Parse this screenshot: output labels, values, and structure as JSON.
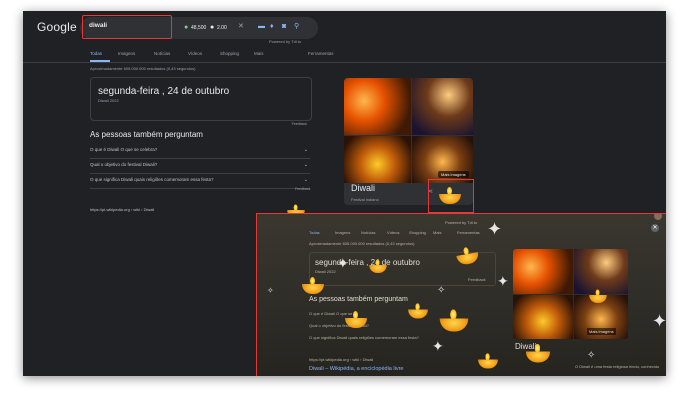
{
  "brand": {
    "logo": "Google"
  },
  "search": {
    "query": "diwali",
    "count_a": "48,500",
    "count_b": "2.00",
    "powered": "Powered by Tdl.to"
  },
  "tabs": [
    {
      "label": "Todas"
    },
    {
      "label": "Imagens"
    },
    {
      "label": "Notícias"
    },
    {
      "label": "Vídeos"
    },
    {
      "label": "Shopping"
    },
    {
      "label": "Mais"
    },
    {
      "label": "Ferramentas"
    }
  ],
  "stats": "Aproximadamente 605.000.000 resultados (0,43 segundos)",
  "date_card": {
    "main": "segunda-feira , 24 de outubro",
    "sub": "Diwali 2022",
    "feedback": "Feedback"
  },
  "paa": {
    "title": "As pessoas também perguntam",
    "questions": [
      "O que é Diwali O que se celebra?",
      "Qual o objetivo do festival Diwali?",
      "O que significa Diwali quais religiões comemoram essa festa?"
    ],
    "feedback": "Feedback"
  },
  "result": {
    "url": "https://pt.wikipedia.org › wiki › Diwali"
  },
  "knowledge": {
    "title": "Diwali",
    "subtitle": "Festival indiano",
    "more_images": "Mais imagens"
  },
  "overlay": {
    "date_main": "segunda-feira , 24 de outubro",
    "date_sub": "Diwali 2022",
    "paa_title": "As pessoas também perguntam",
    "q1": "O que é Diwali O que se ...",
    "q2": "Qual o objetivo do festival Diwali?",
    "q3": "O que significa Diwali quais religiões comemoram essa festa?",
    "url": "https://pt.wikipedia.org › wiki › Diwali",
    "link": "Diwali – Wikipédia, a enciclopédia livre",
    "kp_title": "Diwali",
    "kp_text": "O Diwali é uma festa religiosa hindu, conhecido",
    "more_images": "Mais imagens",
    "powered": "Powered by Tdl.to",
    "feedback": "Feedback"
  },
  "colors": {
    "bg": "#202124",
    "highlight": "#e53935",
    "link": "#8ab4f8"
  }
}
